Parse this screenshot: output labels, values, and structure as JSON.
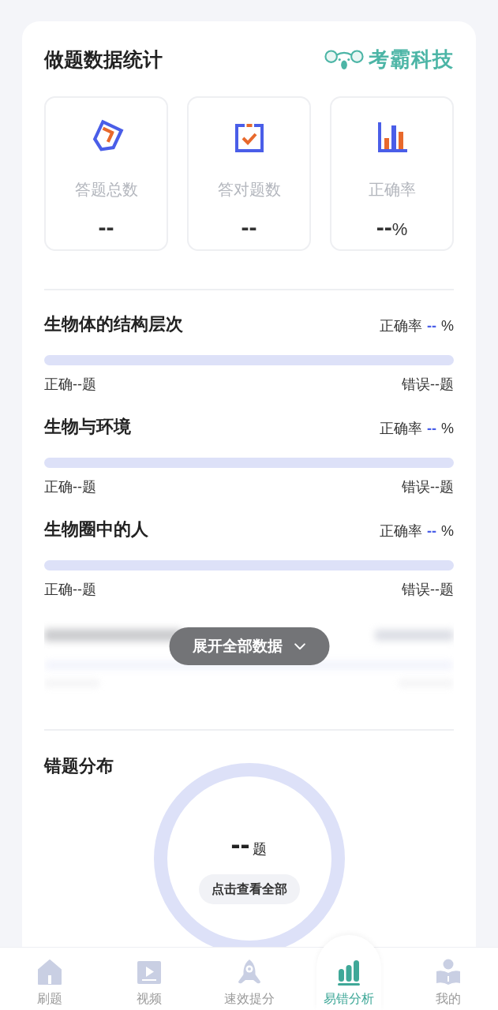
{
  "header": {
    "title": "做题数据统计",
    "logo_text": "考霸科技"
  },
  "stats": [
    {
      "kind": "total",
      "label": "答题总数",
      "value": "--"
    },
    {
      "kind": "correct",
      "label": "答对题数",
      "value": "--"
    },
    {
      "kind": "rate",
      "label": "正确率",
      "value": "--",
      "unit": "%"
    }
  ],
  "topics": [
    {
      "title": "生物体的结构层次",
      "rate_label": "正确率",
      "rate_value": "--",
      "rate_unit": "%",
      "correct": "正确--题",
      "wrong": "错误--题"
    },
    {
      "title": "生物与环境",
      "rate_label": "正确率",
      "rate_value": "--",
      "rate_unit": "%",
      "correct": "正确--题",
      "wrong": "错误--题"
    },
    {
      "title": "生物圈中的人",
      "rate_label": "正确率",
      "rate_value": "--",
      "rate_unit": "%",
      "correct": "正确--题",
      "wrong": "错误--题"
    }
  ],
  "expand_button": {
    "label": "展开全部数据"
  },
  "distribution": {
    "title": "错题分布",
    "count": "--",
    "unit": "题",
    "button": "点击查看全部"
  },
  "nav": [
    {
      "kind": "home",
      "label": "刷题",
      "selected": false
    },
    {
      "kind": "video",
      "label": "视频",
      "selected": false
    },
    {
      "kind": "boost",
      "label": "速效提分",
      "selected": false
    },
    {
      "kind": "analysis",
      "label": "易错分析",
      "selected": true
    },
    {
      "kind": "profile",
      "label": "我的",
      "selected": false
    }
  ]
}
